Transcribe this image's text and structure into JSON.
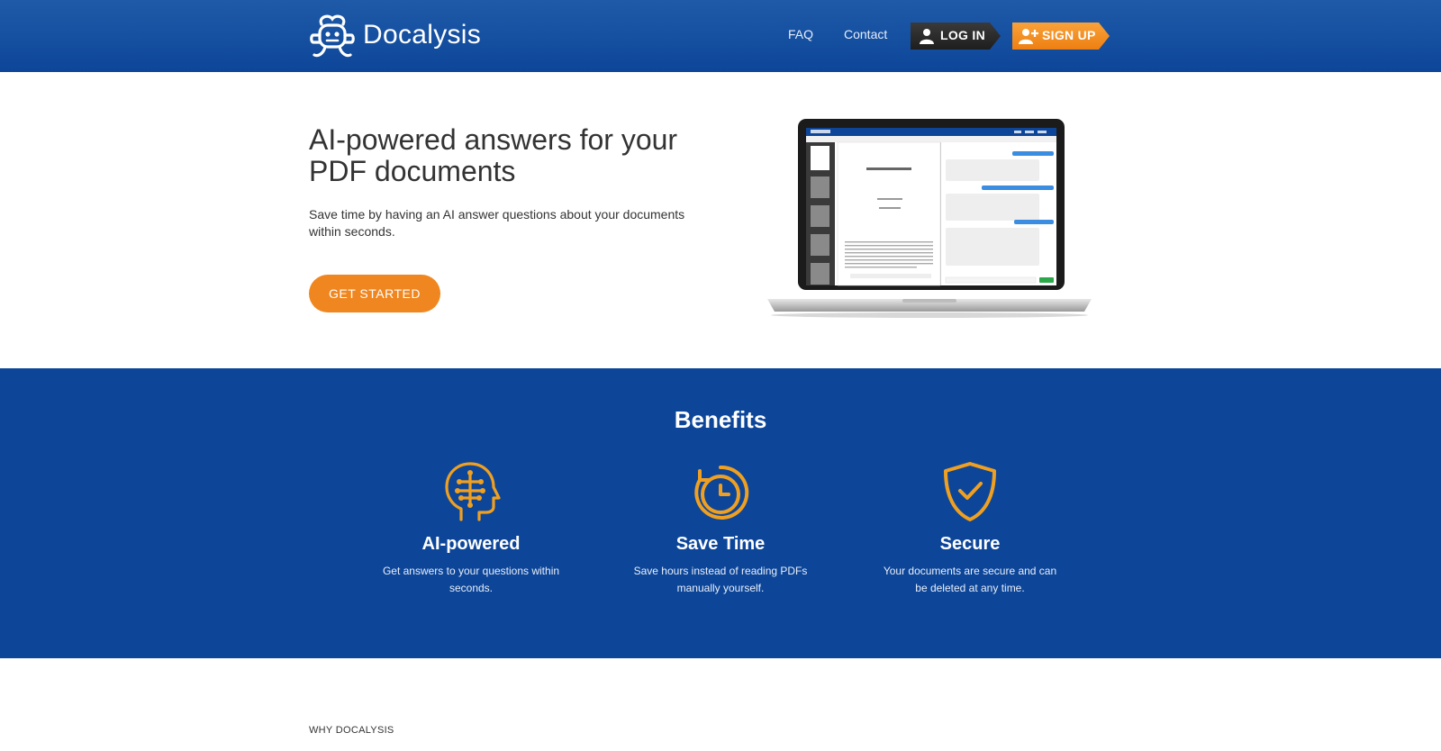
{
  "header": {
    "brand": "Docalysis",
    "nav": {
      "faq": "FAQ",
      "contact": "Contact"
    },
    "login_label": "LOG IN",
    "signup_label": "SIGN UP"
  },
  "hero": {
    "title": "AI-powered answers for your PDF documents",
    "subtitle": "Save time by having an AI answer questions about your documents within seconds.",
    "cta_label": "GET STARTED"
  },
  "benefits": {
    "title": "Benefits",
    "items": [
      {
        "icon": "ai-head-icon",
        "name": "AI-powered",
        "desc": "Get answers to your questions within seconds."
      },
      {
        "icon": "stopwatch-icon",
        "name": "Save Time",
        "desc": "Save hours instead of reading PDFs manually yourself."
      },
      {
        "icon": "shield-check-icon",
        "name": "Secure",
        "desc": "Your documents are secure and can be deleted at any time."
      }
    ]
  },
  "why": {
    "label": "WHY DOCALYSIS"
  },
  "colors": {
    "brand_blue": "#0d4699",
    "accent_orange": "#f0861f",
    "login_dark": "#2b2b2b"
  }
}
